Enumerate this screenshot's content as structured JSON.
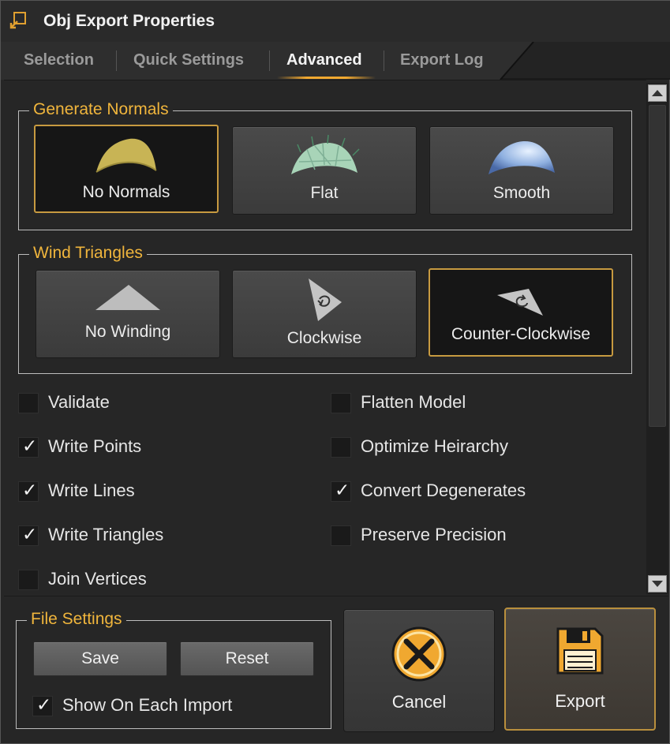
{
  "window": {
    "title": "Obj Export Properties",
    "icon": "app-icon"
  },
  "tabs": [
    {
      "label": "Selection",
      "active": false
    },
    {
      "label": "Quick Settings",
      "active": false
    },
    {
      "label": "Advanced",
      "active": true
    },
    {
      "label": "Export Log",
      "active": false
    }
  ],
  "generate_normals": {
    "legend": "Generate Normals",
    "options": [
      {
        "label": "No Normals",
        "icon": "no-normals-icon",
        "selected": true
      },
      {
        "label": "Flat",
        "icon": "flat-normals-icon",
        "selected": false
      },
      {
        "label": "Smooth",
        "icon": "smooth-normals-icon",
        "selected": false
      }
    ]
  },
  "wind_triangles": {
    "legend": "Wind Triangles",
    "options": [
      {
        "label": "No Winding",
        "icon": "no-winding-icon",
        "selected": false
      },
      {
        "label": "Clockwise",
        "icon": "clockwise-icon",
        "selected": false
      },
      {
        "label": "Counter-Clockwise",
        "icon": "counter-clockwise-icon",
        "selected": true
      }
    ]
  },
  "checkboxes": {
    "left": [
      {
        "label": "Validate",
        "checked": false
      },
      {
        "label": "Write Points",
        "checked": true
      },
      {
        "label": "Write Lines",
        "checked": true
      },
      {
        "label": "Write Triangles",
        "checked": true
      },
      {
        "label": "Join Vertices",
        "checked": false
      }
    ],
    "right": [
      {
        "label": "Flatten Model",
        "checked": false
      },
      {
        "label": "Optimize Heirarchy",
        "checked": false
      },
      {
        "label": "Convert Degenerates",
        "checked": true
      },
      {
        "label": "Preserve Precision",
        "checked": false
      }
    ],
    "check_glyph": "✓"
  },
  "file_settings": {
    "legend": "File Settings",
    "save_label": "Save",
    "reset_label": "Reset",
    "show_on_import": {
      "label": "Show On Each Import",
      "checked": true
    }
  },
  "actions": {
    "cancel_label": "Cancel",
    "export_label": "Export"
  },
  "colors": {
    "accent": "#f0b53c",
    "selected_border": "#c79a40",
    "background": "#262626"
  }
}
